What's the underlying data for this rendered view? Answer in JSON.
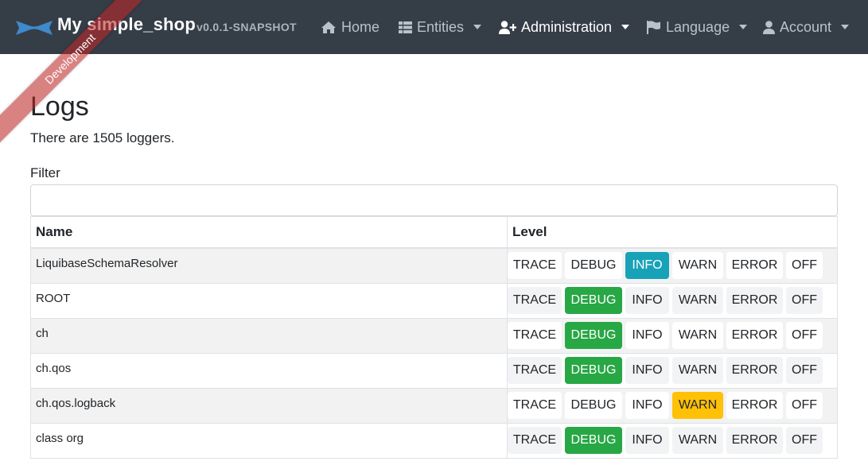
{
  "navbar": {
    "brand_name": "My simple_shop",
    "brand_version": "v0.0.1-SNAPSHOT",
    "items": [
      {
        "label": "Home",
        "icon": "home-icon"
      },
      {
        "label": "Entities",
        "icon": "list-icon"
      },
      {
        "label": "Administration",
        "icon": "user-plus-icon"
      },
      {
        "label": "Language",
        "icon": "flag-icon"
      },
      {
        "label": "Account",
        "icon": "user-icon"
      }
    ]
  },
  "ribbon": {
    "label": "Development"
  },
  "page": {
    "title": "Logs",
    "logger_count_text": "There are 1505 loggers.",
    "filter_label": "Filter",
    "filter_value": "",
    "filter_placeholder": ""
  },
  "table": {
    "columns": [
      "Name",
      "Level"
    ],
    "level_labels": [
      "TRACE",
      "DEBUG",
      "INFO",
      "WARN",
      "ERROR",
      "OFF"
    ],
    "rows": [
      {
        "name": "LiquibaseSchemaResolver",
        "level": "INFO"
      },
      {
        "name": "ROOT",
        "level": "DEBUG"
      },
      {
        "name": "ch",
        "level": "DEBUG"
      },
      {
        "name": "ch.qos",
        "level": "DEBUG"
      },
      {
        "name": "ch.qos.logback",
        "level": "WARN"
      },
      {
        "name": "class org",
        "level": "DEBUG"
      }
    ]
  },
  "colors": {
    "navbar_bg": "#353d47",
    "info": "#17a2b8",
    "debug": "#28a745",
    "warn": "#ffc107",
    "ribbon": "#be2828"
  }
}
